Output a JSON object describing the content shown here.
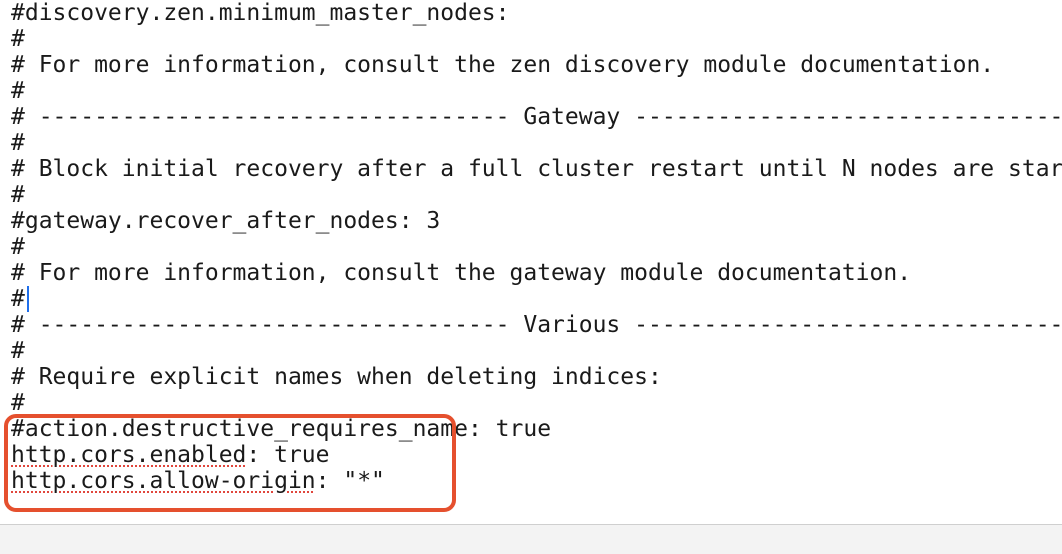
{
  "editor": {
    "lines": [
      "#discovery.zen.minimum_master_nodes:",
      "#",
      "# For more information, consult the zen discovery module documentation.",
      "#",
      "# ---------------------------------- Gateway -----------------------------------",
      "#",
      "# Block initial recovery after a full cluster restart until N nodes are started:",
      "#",
      "#gateway.recover_after_nodes: 3",
      "#",
      "# For more information, consult the gateway module documentation.",
      "#",
      "# ---------------------------------- Various -----------------------------------",
      "#",
      "# Require explicit names when deleting indices:",
      "#",
      "#action.destructive_requires_name: true"
    ],
    "cors_enabled": {
      "key": "http.cors.enabled",
      "sep": ": ",
      "value": "true"
    },
    "cors_origin": {
      "key": "http.cors.allow-origin",
      "sep": ": ",
      "value": "\"*\""
    }
  },
  "colors": {
    "highlight_border": "#e5502e",
    "spellcheck_underline": "#e0463c",
    "caret": "#1f6feb",
    "text": "#1a1a1a"
  }
}
